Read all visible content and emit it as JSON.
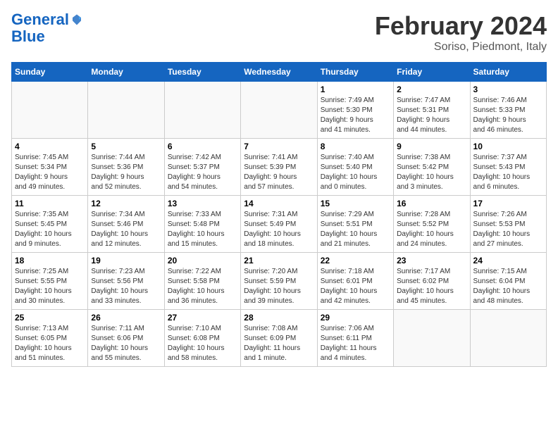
{
  "header": {
    "logo_line1": "General",
    "logo_line2": "Blue",
    "title": "February 2024",
    "subtitle": "Soriso, Piedmont, Italy"
  },
  "columns": [
    "Sunday",
    "Monday",
    "Tuesday",
    "Wednesday",
    "Thursday",
    "Friday",
    "Saturday"
  ],
  "weeks": [
    [
      {
        "day": "",
        "info": ""
      },
      {
        "day": "",
        "info": ""
      },
      {
        "day": "",
        "info": ""
      },
      {
        "day": "",
        "info": ""
      },
      {
        "day": "1",
        "info": "Sunrise: 7:49 AM\nSunset: 5:30 PM\nDaylight: 9 hours\nand 41 minutes."
      },
      {
        "day": "2",
        "info": "Sunrise: 7:47 AM\nSunset: 5:31 PM\nDaylight: 9 hours\nand 44 minutes."
      },
      {
        "day": "3",
        "info": "Sunrise: 7:46 AM\nSunset: 5:33 PM\nDaylight: 9 hours\nand 46 minutes."
      }
    ],
    [
      {
        "day": "4",
        "info": "Sunrise: 7:45 AM\nSunset: 5:34 PM\nDaylight: 9 hours\nand 49 minutes."
      },
      {
        "day": "5",
        "info": "Sunrise: 7:44 AM\nSunset: 5:36 PM\nDaylight: 9 hours\nand 52 minutes."
      },
      {
        "day": "6",
        "info": "Sunrise: 7:42 AM\nSunset: 5:37 PM\nDaylight: 9 hours\nand 54 minutes."
      },
      {
        "day": "7",
        "info": "Sunrise: 7:41 AM\nSunset: 5:39 PM\nDaylight: 9 hours\nand 57 minutes."
      },
      {
        "day": "8",
        "info": "Sunrise: 7:40 AM\nSunset: 5:40 PM\nDaylight: 10 hours\nand 0 minutes."
      },
      {
        "day": "9",
        "info": "Sunrise: 7:38 AM\nSunset: 5:42 PM\nDaylight: 10 hours\nand 3 minutes."
      },
      {
        "day": "10",
        "info": "Sunrise: 7:37 AM\nSunset: 5:43 PM\nDaylight: 10 hours\nand 6 minutes."
      }
    ],
    [
      {
        "day": "11",
        "info": "Sunrise: 7:35 AM\nSunset: 5:45 PM\nDaylight: 10 hours\nand 9 minutes."
      },
      {
        "day": "12",
        "info": "Sunrise: 7:34 AM\nSunset: 5:46 PM\nDaylight: 10 hours\nand 12 minutes."
      },
      {
        "day": "13",
        "info": "Sunrise: 7:33 AM\nSunset: 5:48 PM\nDaylight: 10 hours\nand 15 minutes."
      },
      {
        "day": "14",
        "info": "Sunrise: 7:31 AM\nSunset: 5:49 PM\nDaylight: 10 hours\nand 18 minutes."
      },
      {
        "day": "15",
        "info": "Sunrise: 7:29 AM\nSunset: 5:51 PM\nDaylight: 10 hours\nand 21 minutes."
      },
      {
        "day": "16",
        "info": "Sunrise: 7:28 AM\nSunset: 5:52 PM\nDaylight: 10 hours\nand 24 minutes."
      },
      {
        "day": "17",
        "info": "Sunrise: 7:26 AM\nSunset: 5:53 PM\nDaylight: 10 hours\nand 27 minutes."
      }
    ],
    [
      {
        "day": "18",
        "info": "Sunrise: 7:25 AM\nSunset: 5:55 PM\nDaylight: 10 hours\nand 30 minutes."
      },
      {
        "day": "19",
        "info": "Sunrise: 7:23 AM\nSunset: 5:56 PM\nDaylight: 10 hours\nand 33 minutes."
      },
      {
        "day": "20",
        "info": "Sunrise: 7:22 AM\nSunset: 5:58 PM\nDaylight: 10 hours\nand 36 minutes."
      },
      {
        "day": "21",
        "info": "Sunrise: 7:20 AM\nSunset: 5:59 PM\nDaylight: 10 hours\nand 39 minutes."
      },
      {
        "day": "22",
        "info": "Sunrise: 7:18 AM\nSunset: 6:01 PM\nDaylight: 10 hours\nand 42 minutes."
      },
      {
        "day": "23",
        "info": "Sunrise: 7:17 AM\nSunset: 6:02 PM\nDaylight: 10 hours\nand 45 minutes."
      },
      {
        "day": "24",
        "info": "Sunrise: 7:15 AM\nSunset: 6:04 PM\nDaylight: 10 hours\nand 48 minutes."
      }
    ],
    [
      {
        "day": "25",
        "info": "Sunrise: 7:13 AM\nSunset: 6:05 PM\nDaylight: 10 hours\nand 51 minutes."
      },
      {
        "day": "26",
        "info": "Sunrise: 7:11 AM\nSunset: 6:06 PM\nDaylight: 10 hours\nand 55 minutes."
      },
      {
        "day": "27",
        "info": "Sunrise: 7:10 AM\nSunset: 6:08 PM\nDaylight: 10 hours\nand 58 minutes."
      },
      {
        "day": "28",
        "info": "Sunrise: 7:08 AM\nSunset: 6:09 PM\nDaylight: 11 hours\nand 1 minute."
      },
      {
        "day": "29",
        "info": "Sunrise: 7:06 AM\nSunset: 6:11 PM\nDaylight: 11 hours\nand 4 minutes."
      },
      {
        "day": "",
        "info": ""
      },
      {
        "day": "",
        "info": ""
      }
    ]
  ]
}
